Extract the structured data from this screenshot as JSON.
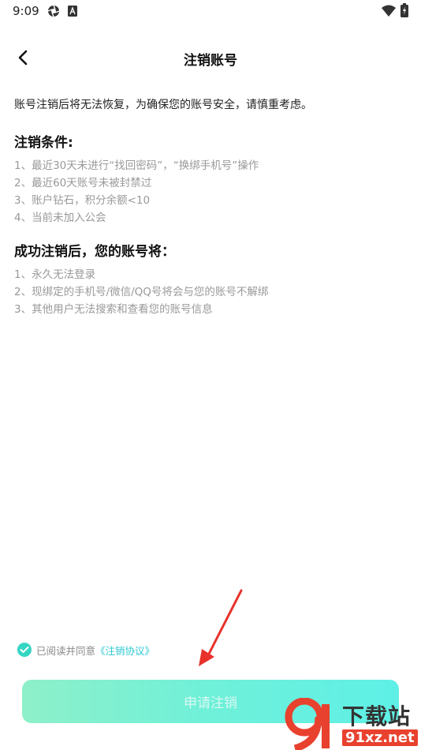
{
  "status_bar": {
    "time": "9:09"
  },
  "header": {
    "title": "注销账号",
    "back_icon": "chevron-left-icon"
  },
  "intro": "账号注销后将无法恢复，为确保您的账号安全，请慎重考虑。",
  "conditions": {
    "title": "注销条件:",
    "items": [
      "1、最近30天未进行“找回密码”，“换绑手机号”操作",
      "2、最近60天账号未被封禁过",
      "3、账户钻石，积分余额<10",
      "4、当前未加入公会"
    ]
  },
  "results": {
    "title": "成功注销后，您的账号将：",
    "items": [
      "1、永久无法登录",
      "2、现绑定的手机号/微信/QQ号将会与您的账号不解绑",
      "3、其他用户无法搜索和查看您的账号信息"
    ]
  },
  "agreement": {
    "checked": true,
    "text": "已阅读并同意",
    "link": "《注销协议》"
  },
  "apply_button": {
    "label": "申请注销"
  },
  "watermark": {
    "logo_text": "9",
    "title": "下载站",
    "url": "91xz.net"
  },
  "colors": {
    "accent": "#35d6c3",
    "link": "#2cc9d2",
    "annotation_arrow": "#e8312a",
    "watermark_red": "#e8412e"
  }
}
